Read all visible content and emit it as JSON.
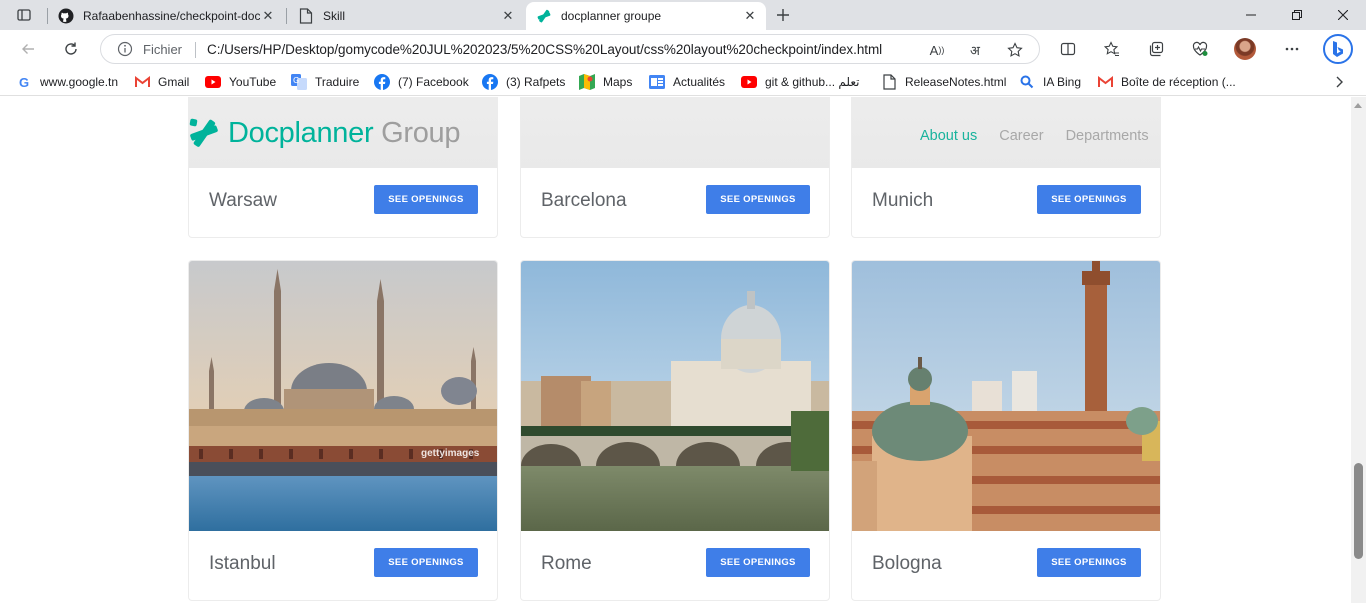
{
  "browser": {
    "tabs": [
      {
        "title": "Rafaabenhassine/checkpoint-doc",
        "icon": "github-icon",
        "active": false
      },
      {
        "title": "Skill",
        "icon": "page-icon",
        "active": false
      },
      {
        "title": "docplanner groupe",
        "icon": "docplanner-icon",
        "active": true
      }
    ],
    "address": {
      "label": "Fichier",
      "url": "C:/Users/HP/Desktop/gomycode%20JUL%202023/5%20CSS%20Layout/css%20layout%20checkpoint/index.html"
    },
    "bookmarks": [
      {
        "label": "www.google.tn",
        "icon": "google-icon",
        "color": "#4285f4"
      },
      {
        "label": "Gmail",
        "icon": "gmail-icon",
        "color": "#ea4335"
      },
      {
        "label": "YouTube",
        "icon": "youtube-icon",
        "color": "#ff0000"
      },
      {
        "label": "Traduire",
        "icon": "translate-icon",
        "color": "#4285f4"
      },
      {
        "label": "(7) Facebook",
        "icon": "facebook-icon",
        "color": "#1877f2"
      },
      {
        "label": "(3) Rafpets",
        "icon": "facebook-icon",
        "color": "#1877f2"
      },
      {
        "label": "Maps",
        "icon": "maps-icon",
        "color": "#34a853"
      },
      {
        "label": "Actualités",
        "icon": "news-icon",
        "color": "#4285f4"
      },
      {
        "label": "git & github... تعلم",
        "icon": "youtube-icon",
        "color": "#ff0000"
      },
      {
        "label": "ReleaseNotes.html",
        "icon": "file-icon",
        "color": "#5f6368"
      },
      {
        "label": "IA Bing",
        "icon": "search-icon",
        "color": "#2a73e8"
      },
      {
        "label": "Boîte de réception (...",
        "icon": "gmail-icon",
        "color": "#ea4335"
      }
    ]
  },
  "site": {
    "logo": {
      "brand": "Docplanner",
      "group": " Group"
    },
    "nav": [
      {
        "label": "About us",
        "active": true
      },
      {
        "label": "Career",
        "active": false
      },
      {
        "label": "Departments",
        "active": false
      }
    ],
    "colors": {
      "brand": "#00b39b",
      "button": "#3f7ee8"
    }
  },
  "offices": [
    {
      "city": "Warsaw",
      "button": "SEE OPENINGS"
    },
    {
      "city": "Barcelona",
      "button": "SEE OPENINGS"
    },
    {
      "city": "Munich",
      "button": "SEE OPENINGS"
    },
    {
      "city": "Istanbul",
      "button": "SEE OPENINGS",
      "watermark": "gettyimages"
    },
    {
      "city": "Rome",
      "button": "SEE OPENINGS"
    },
    {
      "city": "Bologna",
      "button": "SEE OPENINGS"
    }
  ]
}
